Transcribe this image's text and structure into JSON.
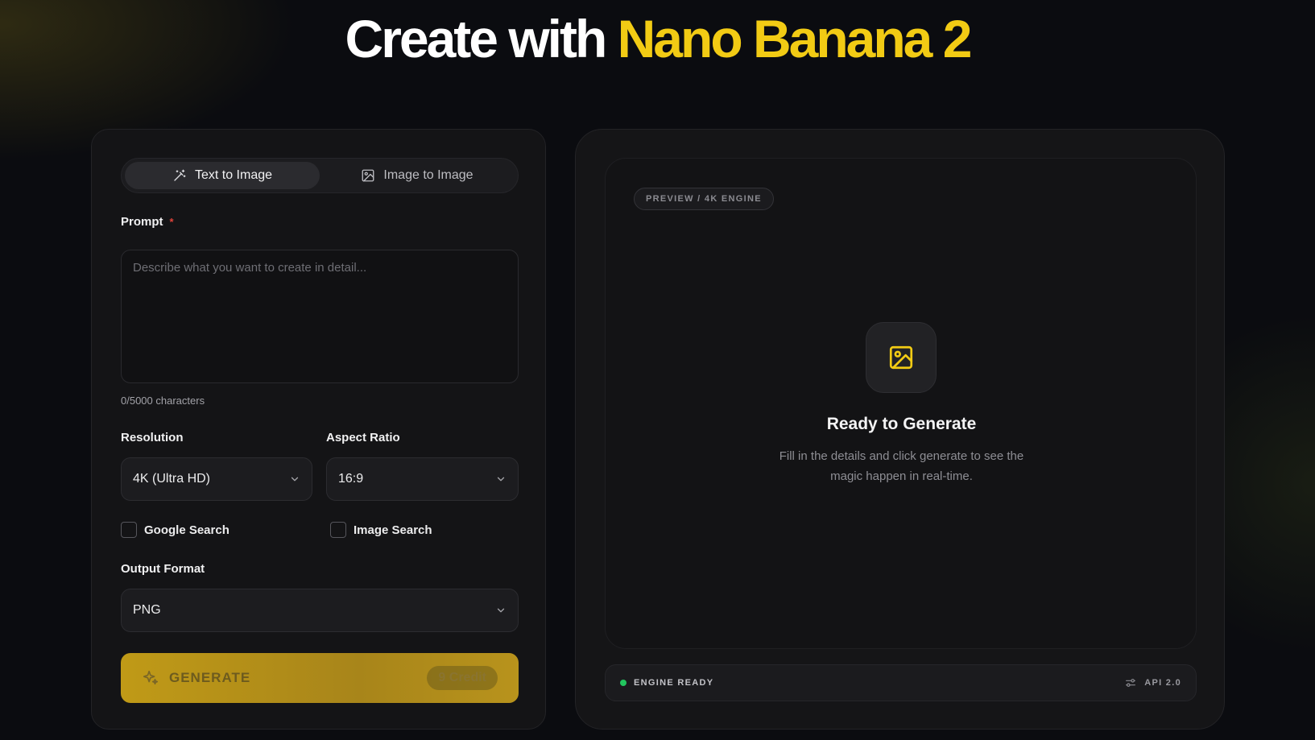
{
  "hero": {
    "title_white": "Create with",
    "title_accent": "Nano Banana 2"
  },
  "colors": {
    "accent": "#f2cb14",
    "background": "#0b0c10",
    "status_ok": "#22c55e"
  },
  "mode_tabs": [
    {
      "label": "Text to Image",
      "icon": "magic-wand-icon",
      "active": true
    },
    {
      "label": "Image to Image",
      "icon": "image-icon",
      "active": false
    }
  ],
  "prompt": {
    "label": "Prompt",
    "required_mark": "*",
    "value": "",
    "placeholder": "Describe what you want to create in detail...",
    "char_count": "0/5000 characters"
  },
  "resolution": {
    "label": "Resolution",
    "value": "4K (Ultra HD)"
  },
  "aspect_ratio": {
    "label": "Aspect Ratio",
    "value": "16:9"
  },
  "google_search": {
    "label": "Google Search",
    "checked": false
  },
  "image_search": {
    "label": "Image Search",
    "checked": false
  },
  "output_format": {
    "label": "Output Format",
    "value": "PNG"
  },
  "generate": {
    "label": "GENERATE",
    "icon": "sparkle-icon",
    "credit": "9 Credit"
  },
  "preview": {
    "badge": "PREVIEW / 4K ENGINE",
    "icon": "image-icon",
    "title": "Ready to Generate",
    "line1": "Fill in the details and click generate to see the",
    "line2": "magic happen in real-time."
  },
  "status": {
    "engine": "ENGINE READY",
    "api": "API 2.0",
    "api_icon": "sliders-icon"
  }
}
